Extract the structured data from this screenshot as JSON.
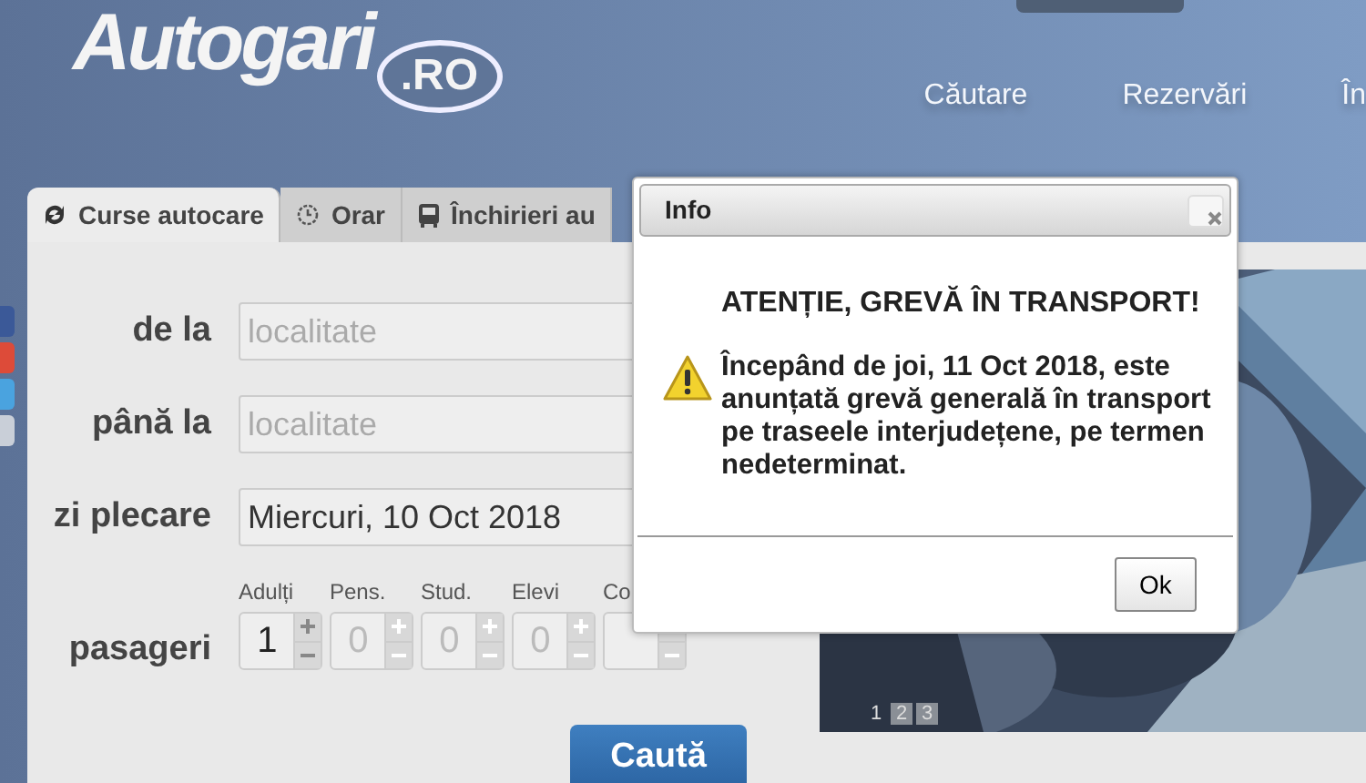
{
  "header": {
    "logo": {
      "text": "Autogari",
      "suffix": ".RO"
    },
    "nav": [
      {
        "label": "Căutare"
      },
      {
        "label": "Rezervări"
      },
      {
        "label": "În"
      }
    ]
  },
  "tabs": [
    {
      "label": "Curse autocare",
      "selected": true
    },
    {
      "label": "Orar",
      "selected": false
    },
    {
      "label": "Închirieri au",
      "selected": false
    }
  ],
  "form": {
    "fields": [
      {
        "label": "de la",
        "placeholder": "localitate"
      },
      {
        "label": "până la",
        "placeholder": "localitate"
      },
      {
        "label": "zi plecare",
        "value": "Miercuri, 10 Oct 2018"
      }
    ],
    "passengers": {
      "label": "pasageri",
      "counters": [
        {
          "label": "Adulți",
          "value": "1",
          "disabled": false
        },
        {
          "label": "Pens.",
          "value": "0",
          "disabled": true
        },
        {
          "label": "Stud.",
          "value": "0",
          "disabled": true
        },
        {
          "label": "Elevi",
          "value": "0",
          "disabled": true
        },
        {
          "label": "Co",
          "disabled": true
        }
      ]
    },
    "submit": "Caută"
  },
  "slider": {
    "kind": "picture",
    "pages": [
      {
        "label": "1",
        "selected": true
      },
      {
        "label": "2",
        "selected": false
      },
      {
        "label": "3",
        "selected": false
      }
    ]
  },
  "dialog": {
    "title": "Info",
    "heading": "ATENȚIE, GREVĂ ÎN TRANSPORT!",
    "message": "Începând de joi, 11 Oct 2018, este anunțată grevă generală în transport pe traseele interjudețene, pe termen nedeterminat.",
    "button": "Ok"
  }
}
